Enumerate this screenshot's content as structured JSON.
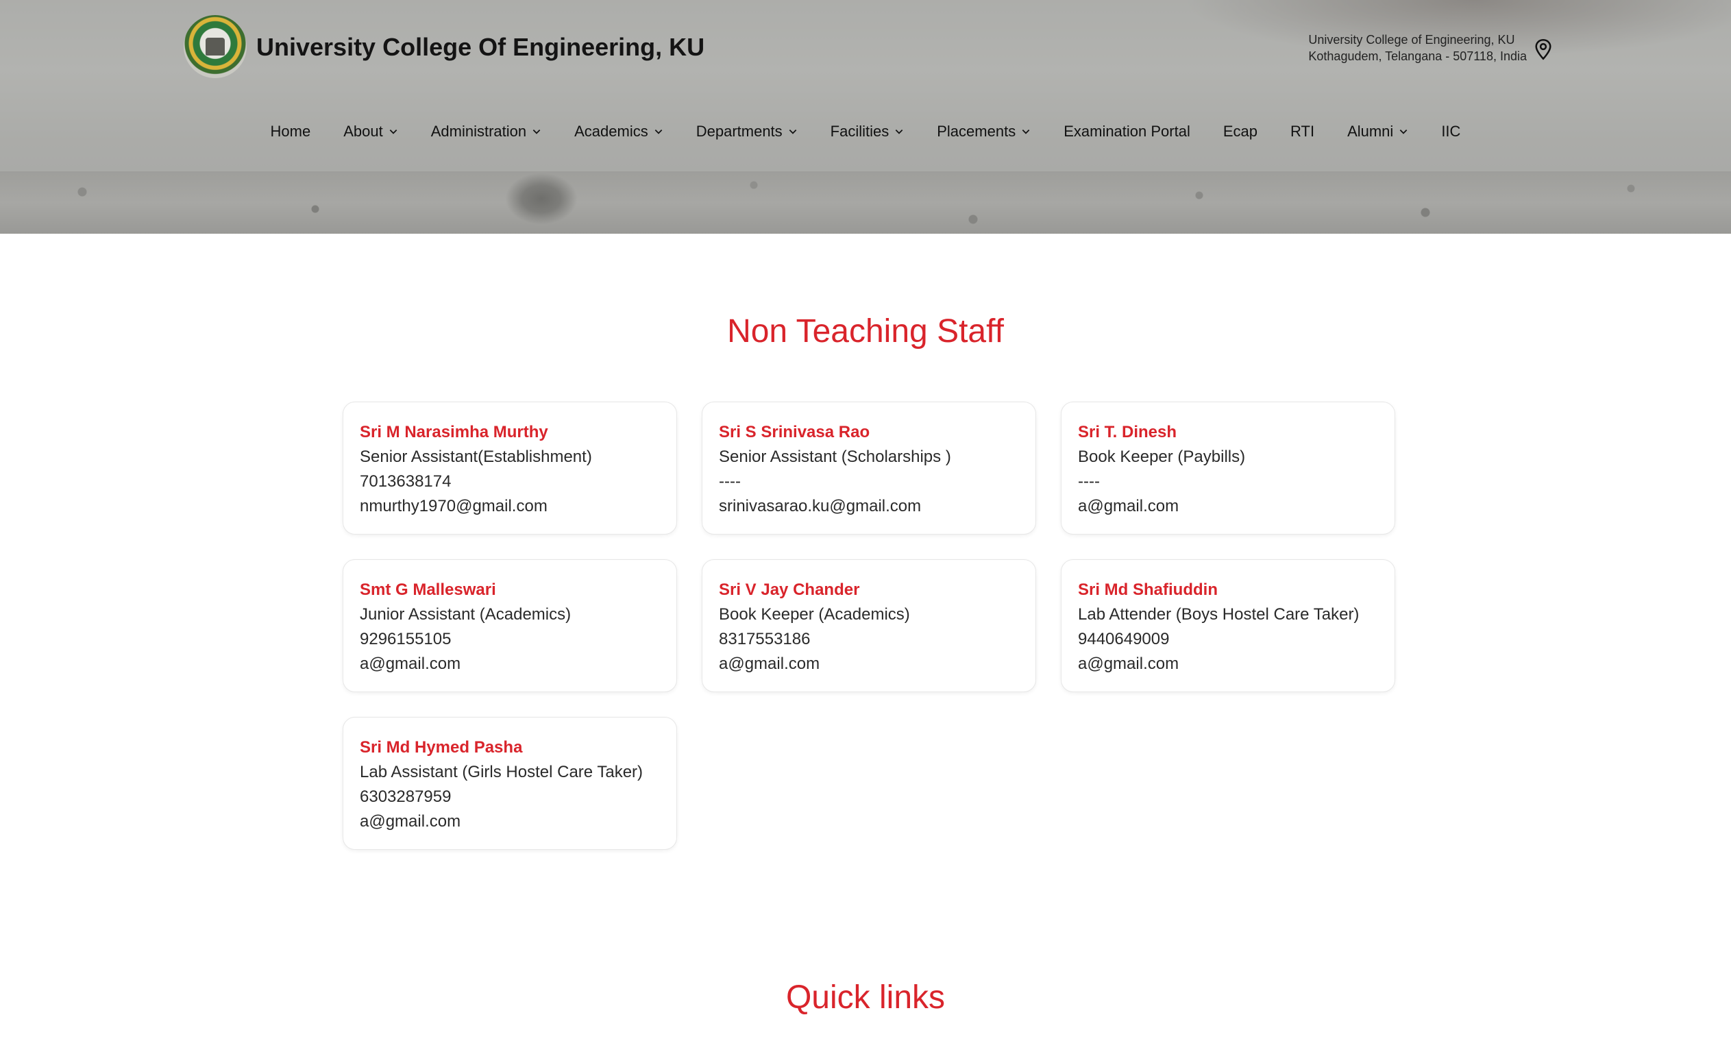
{
  "header": {
    "title": "University College Of Engineering, KU",
    "address_line1": "University College of Engineering, KU",
    "address_line2": "Kothagudem, Telangana - 507118, India",
    "logo_icon": "university-seal-logo",
    "location_icon": "map-pin-icon"
  },
  "nav": {
    "items": [
      {
        "label": "Home",
        "dropdown": false
      },
      {
        "label": "About",
        "dropdown": true
      },
      {
        "label": "Administration",
        "dropdown": true
      },
      {
        "label": "Academics",
        "dropdown": true
      },
      {
        "label": "Departments",
        "dropdown": true
      },
      {
        "label": "Facilities",
        "dropdown": true
      },
      {
        "label": "Placements",
        "dropdown": true
      },
      {
        "label": "Examination Portal",
        "dropdown": false
      },
      {
        "label": "Ecap",
        "dropdown": false
      },
      {
        "label": "RTI",
        "dropdown": false
      },
      {
        "label": "Alumni",
        "dropdown": true
      },
      {
        "label": "IIC",
        "dropdown": false
      }
    ]
  },
  "main": {
    "section_title": "Non Teaching Staff",
    "staff": [
      {
        "name": "Sri M Narasimha Murthy",
        "role": "Senior Assistant(Establishment)",
        "phone": "7013638174",
        "email": "nmurthy1970@gmail.com"
      },
      {
        "name": "Sri S Srinivasa Rao",
        "role": "Senior Assistant (Scholarships )",
        "phone": "----",
        "email": "srinivasarao.ku@gmail.com"
      },
      {
        "name": "Sri T. Dinesh",
        "role": "Book Keeper (Paybills)",
        "phone": "----",
        "email": "a@gmail.com"
      },
      {
        "name": "Smt G Malleswari",
        "role": "Junior Assistant (Academics)",
        "phone": "9296155105",
        "email": "a@gmail.com"
      },
      {
        "name": "Sri V Jay Chander",
        "role": "Book Keeper (Academics)",
        "phone": "8317553186",
        "email": "a@gmail.com"
      },
      {
        "name": "Sri Md Shafiuddin",
        "role": "Lab Attender (Boys Hostel Care Taker)",
        "phone": "9440649009",
        "email": "a@gmail.com"
      },
      {
        "name": "Sri Md Hymed Pasha",
        "role": "Lab Assistant (Girls Hostel Care Taker)",
        "phone": "6303287959",
        "email": "a@gmail.com"
      }
    ],
    "quick_links_title": "Quick links"
  },
  "colors": {
    "accent": "#d9242b",
    "text": "#2a2a2a"
  }
}
